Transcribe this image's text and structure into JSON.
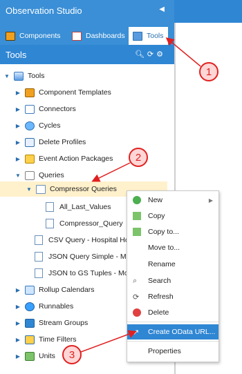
{
  "app": {
    "title": "Observation Studio",
    "collapse_icon": "chevron-left-icon"
  },
  "tabs": [
    {
      "label": "Components",
      "icon": "components-icon"
    },
    {
      "label": "Dashboards",
      "icon": "dashboards-icon"
    },
    {
      "label": "Tools",
      "icon": "tools-icon",
      "active": true
    }
  ],
  "tools_panel": {
    "title": "Tools",
    "header_icons": [
      "search-icon",
      "refresh-icon",
      "gear-icon"
    ]
  },
  "tree": {
    "root": "Tools",
    "items": [
      "Component Templates",
      "Connectors",
      "Cycles",
      "Delete Profiles",
      "Event Action Packages",
      "Queries",
      "Compressor Queries",
      "All_Last_Values",
      "Compressor_Query",
      "CSV Query - Hospital Hour",
      "JSON Query Simple - Monn",
      "JSON to GS Tuples - Monn",
      "Rollup Calendars",
      "Runnables",
      "Stream Groups",
      "Time Filters",
      "Units"
    ]
  },
  "context_menu": {
    "items": [
      "New",
      "Copy",
      "Copy to...",
      "Move to...",
      "Rename",
      "Search",
      "Refresh",
      "Delete",
      "Create OData URL...",
      "Properties"
    ],
    "highlighted": "Create OData URL..."
  },
  "callouts": [
    "1",
    "2",
    "3"
  ],
  "colors": {
    "header": "#3a8fd6",
    "header_dark": "#2f86d3",
    "selection": "#fff1cc",
    "callout": "#e02020"
  }
}
